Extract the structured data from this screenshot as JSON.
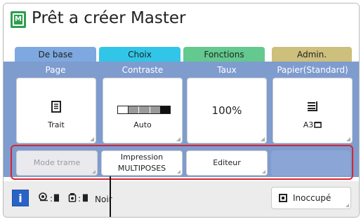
{
  "title": "Prêt a créer Master",
  "master_icon_letter": "M",
  "tabs": [
    {
      "label": "De base",
      "color": "#7ea8e0",
      "active": true
    },
    {
      "label": "Choix",
      "color": "#31c6e8",
      "active": false
    },
    {
      "label": "Fonctions",
      "color": "#63c98e",
      "active": false
    },
    {
      "label": "Admin.",
      "color": "#cdbf7c",
      "active": false
    }
  ],
  "columns": [
    {
      "header": "Page",
      "value": "Trait",
      "icon": "document-icon"
    },
    {
      "header": "Contraste",
      "value": "Auto",
      "icon": "contrast-scale-icon"
    },
    {
      "header": "Taux",
      "value": "100%",
      "icon": ""
    },
    {
      "header": "Papier(Standard)",
      "value": "A3",
      "icon": "paper-stack-icon"
    }
  ],
  "buttons": {
    "mode_trame": "Mode trame",
    "impression_line1": "Impression",
    "impression_line2": "MULTIPOSES",
    "editeur": "Editeur"
  },
  "status": {
    "info": "i",
    "drum_count": "█",
    "ink_count": "█",
    "ink_color": "Noir",
    "state": "Inoccupé"
  },
  "colors": {
    "panel": "#7f9ccf",
    "frame": "#d9252f",
    "info": "#2a63c7",
    "contrast_scale": [
      "#ffffff",
      "#9a9a9a",
      "#9a9a9a",
      "#9a9a9a",
      "#111111"
    ]
  }
}
